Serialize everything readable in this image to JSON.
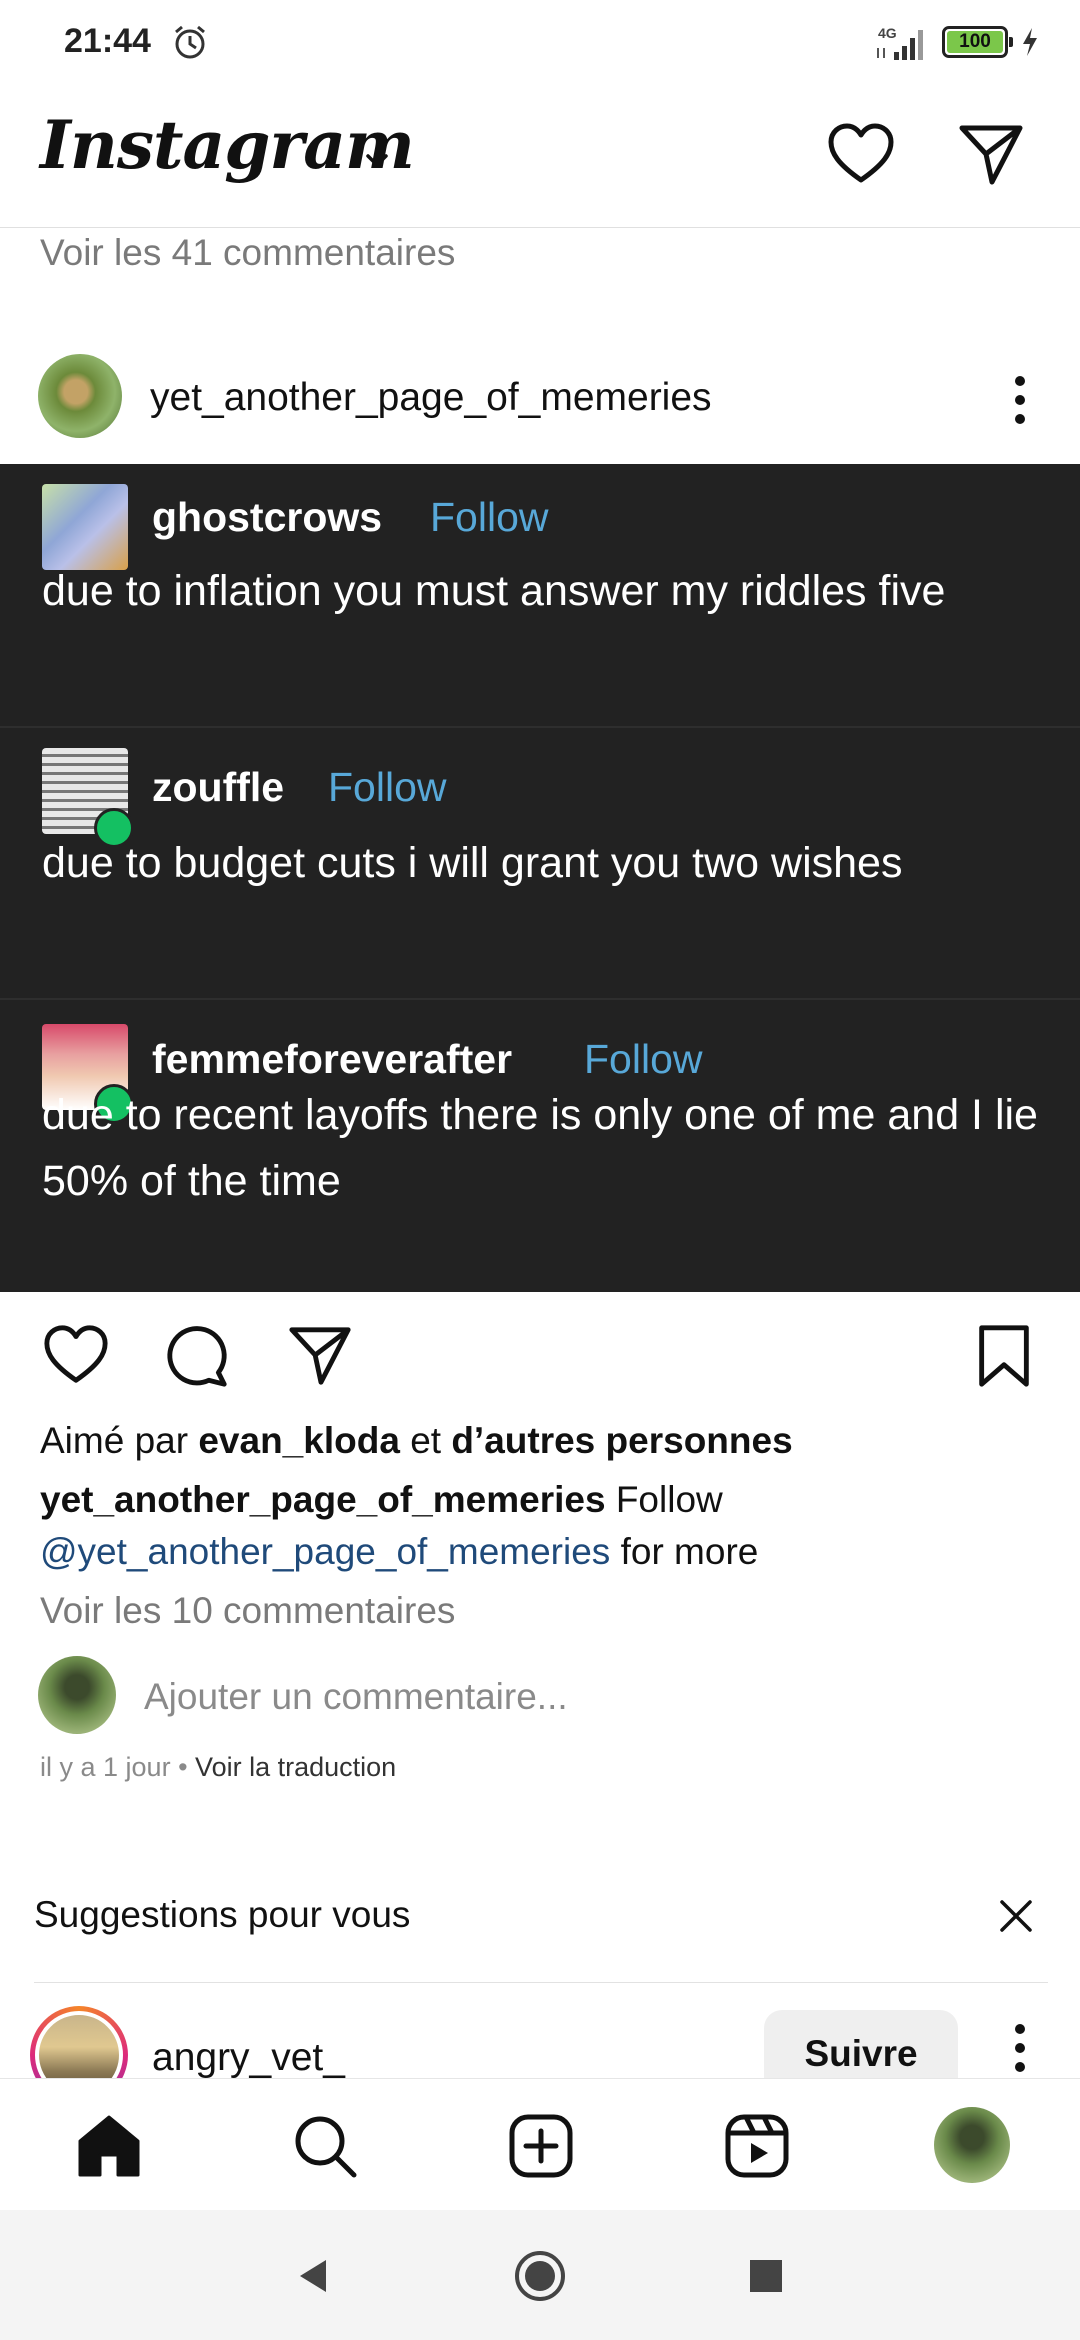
{
  "status_bar": {
    "time": "21:44",
    "network": "4G",
    "battery": "100",
    "icons": [
      "alarm-icon",
      "signal-icon",
      "battery-icon",
      "charging-icon"
    ]
  },
  "header": {
    "logo": "Instagram",
    "icons": [
      "chevron-down-icon",
      "heart-icon",
      "send-icon"
    ]
  },
  "previous_post": {
    "view_comments": "Voir les 41 commentaires"
  },
  "post": {
    "username": "yet_another_page_of_memeries",
    "tumblr_posts": [
      {
        "user": "ghostcrows",
        "follow": "Follow",
        "text": "due to inflation you must answer my riddles five"
      },
      {
        "user": "zouffle",
        "follow": "Follow",
        "text": "due to budget cuts i will grant you two wishes"
      },
      {
        "user": "femmeforeverafter",
        "follow": "Follow",
        "text": "due to recent layoffs there is only one of me and I lie 50% of the time"
      }
    ],
    "likes": {
      "prefix": "Aimé par",
      "user": "evan_kloda",
      "middle": "et",
      "others": "d’autres personnes"
    },
    "caption": {
      "user": "yet_another_page_of_memeries",
      "text1": "Follow",
      "mention": "@yet_another_page_of_memeries",
      "text2": "for more"
    },
    "view_comments": "Voir les 10 commentaires",
    "add_comment_placeholder": "Ajouter un commentaire...",
    "time_ago": "il y a 1 jour",
    "separator": "•",
    "translation": "Voir la traduction"
  },
  "suggestions": {
    "title": "Suggestions pour vous",
    "items": [
      {
        "username": "angry_vet_",
        "button": "Suivre"
      }
    ]
  },
  "bottom_nav": [
    "home-icon",
    "search-icon",
    "create-icon",
    "reels-icon",
    "profile-avatar"
  ],
  "system_nav": [
    "back-icon",
    "home-circle-icon",
    "recents-icon"
  ],
  "colors": {
    "image_background": "#222222",
    "tumblr_follow": "#58a8d8",
    "mention": "#1f4a7a",
    "reblog_badge": "#14c062",
    "battery_fill": "#7bc74a"
  }
}
